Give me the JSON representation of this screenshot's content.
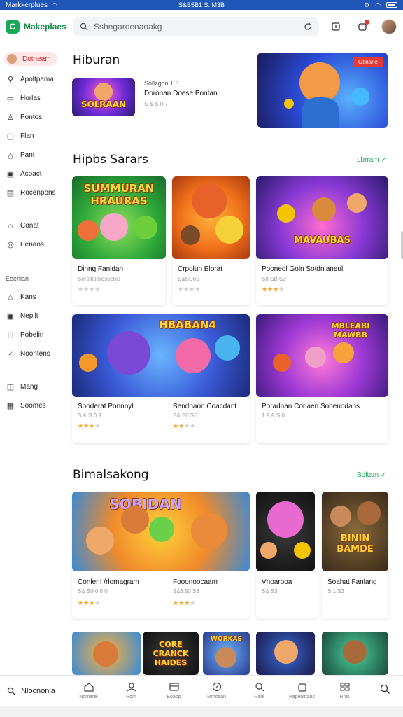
{
  "status": {
    "title": "Markkerplues",
    "clock": "S&B5B1 S: M3B",
    "accent": "#1f56b8"
  },
  "header": {
    "brand": "Makeplaes",
    "search_value": "",
    "search_placeholder": "Sshngaroenaoakg",
    "icons": [
      "refresh-icon",
      "download-icon",
      "notifications-icon",
      "user-avatar"
    ]
  },
  "sidebar": {
    "active": "Dotneam",
    "items": [
      "Apoltpama",
      "Horlas",
      "Pontos",
      "Flan",
      "Pant",
      "Acoact",
      "Rocenpons"
    ],
    "items2": [
      "Conat",
      "Penaos"
    ],
    "section": "Eeenlan",
    "items3": [
      "Kans",
      "Nepllt",
      "Pobelin",
      "Noontens"
    ],
    "items4": [
      "Mang",
      "Soomes"
    ]
  },
  "featured": {
    "title": "Hiburan",
    "item_title": "Sollzgon 1 3",
    "item_name": "Doronan Doese Pontan",
    "item_meta": "S & S 0 7",
    "item_art_text": "SOLRAAN",
    "hero_badge": "Otinane"
  },
  "section1": {
    "title": "Hipbs Sarars",
    "see_all": "Lbrram ✓",
    "cards": [
      {
        "art": "SUMMURAN HRAURAS",
        "name": "Dinng Fanldan",
        "sub": "Soroltitlarosocnis",
        "rating": 0
      },
      {
        "art": "",
        "name": "Crpolun  Elorat",
        "sub": "S&SC65",
        "rating": 0
      },
      {
        "art": "MAVAUBAS",
        "name": "Pooneol Goln Sotdnlaneul",
        "sub": "S8 SB S3",
        "rating": 3
      },
      {
        "art": "HBABAN4",
        "name": "Sooderat  Ponnnyl",
        "sub": "S & S 0 9",
        "rating": 3
      },
      {
        "art": "",
        "name": "Bendnaon  Coacdant",
        "sub": "S& S0 SB",
        "rating": 2
      },
      {
        "art": "MBLEABI MAWBB",
        "name": "Poradnan Corlaen Sobenodans",
        "sub": "1 9 & S 0",
        "rating": 0
      }
    ]
  },
  "section2": {
    "title": "Bimalsakong",
    "see_all": "Boltam ✓",
    "cards": [
      {
        "art": "SOBIDAN",
        "name": "Conlen! /rlomagram",
        "sub": "S& S0 0 5 0",
        "rating": 3
      },
      {
        "art": "",
        "name": "Fooonoocaam",
        "sub": "S&SS0 S3",
        "rating": 3
      },
      {
        "art": "",
        "name": "Vnoarooa",
        "sub": "S& S3",
        "rating": 0
      },
      {
        "art": "BININ BAMDE",
        "name": "Soahat Fanlang",
        "sub": "S 1 S3",
        "rating": 0
      },
      {
        "art": "",
        "name": "",
        "sub": "",
        "rating": 0
      },
      {
        "art": "CORE CRANCK HAIDES",
        "name": "",
        "sub": "",
        "rating": 0
      },
      {
        "art": "WORKAS",
        "name": "",
        "sub": "",
        "rating": 0
      },
      {
        "art": "",
        "name": "",
        "sub": "",
        "rating": 0
      },
      {
        "art": "",
        "name": "",
        "sub": "",
        "rating": 0
      }
    ]
  },
  "bottom": {
    "profile": "Nlocnonla",
    "tabs": [
      "Nomerel",
      "Rom",
      "Eoapp",
      "Mmcean",
      "Rani",
      "Papenittans",
      "Rnis"
    ]
  }
}
